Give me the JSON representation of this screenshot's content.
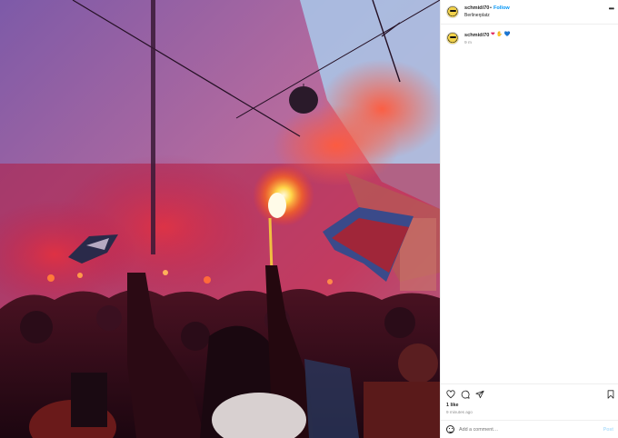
{
  "post": {
    "image_alt": "Photo of fans with red flares and flags on a street",
    "user": {
      "username": "schmidi70",
      "avatar_icon": "smiley-sunglasses-avatar-icon"
    },
    "header": {
      "separator": "•",
      "follow_label": "Follow",
      "location": "Berlinerplatz",
      "more_icon": "more-options-icon"
    },
    "caption": {
      "username": "schmidi70",
      "emojis": [
        "❤",
        "✋",
        "💙"
      ],
      "time": "9 m"
    },
    "actions": {
      "like_icon": "heart-icon",
      "comment_icon": "comment-icon",
      "share_icon": "share-icon",
      "save_icon": "bookmark-icon"
    },
    "likes_label": "1 like",
    "time_ago": "9 minutes ago",
    "comment_box": {
      "placeholder": "Add a comment…",
      "post_label": "Post",
      "emoji_icon": "emoji-icon"
    }
  },
  "colors": {
    "follow_blue": "#0095f6",
    "post_disabled": "#b2dffc",
    "muted_text": "#8e8e8e",
    "divider": "#efefef"
  }
}
